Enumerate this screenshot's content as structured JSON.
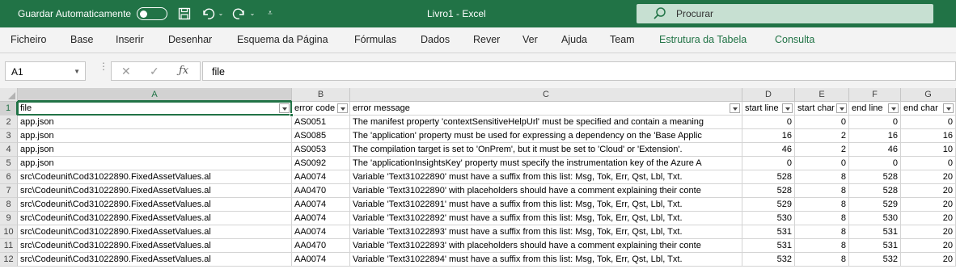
{
  "titlebar": {
    "autosave_label": "Guardar Automaticamente",
    "doc_title": "Livro1  -  Excel",
    "search_label": "Procurar",
    "accent_color": "#217346"
  },
  "ribbon": {
    "tabs": [
      "Ficheiro",
      "Base",
      "Inserir",
      "Desenhar",
      "Esquema da Página",
      "Fórmulas",
      "Dados",
      "Rever",
      "Ver",
      "Ajuda",
      "Team",
      "Estrutura da Tabela",
      "Consulta"
    ]
  },
  "formula_bar": {
    "name_box": "A1",
    "content": "file"
  },
  "columns": [
    "A",
    "B",
    "C",
    "D",
    "E",
    "F",
    "G"
  ],
  "header_row": [
    "file",
    "error code",
    "error message",
    "start line",
    "start char",
    "end line",
    "end char"
  ],
  "rows": [
    {
      "n": "1"
    },
    {
      "n": "2",
      "cells": [
        "app.json",
        "AS0051",
        "The manifest property 'contextSensitiveHelpUrl' must be specified and contain a meaning",
        "0",
        "0",
        "0",
        "0"
      ]
    },
    {
      "n": "3",
      "cells": [
        "app.json",
        "AS0085",
        "The 'application' property must be used for expressing a dependency on the 'Base Applic",
        "16",
        "2",
        "16",
        "16"
      ]
    },
    {
      "n": "4",
      "cells": [
        "app.json",
        "AS0053",
        "The compilation target is set to 'OnPrem', but it must be set to 'Cloud' or 'Extension'.",
        "46",
        "2",
        "46",
        "10"
      ]
    },
    {
      "n": "5",
      "cells": [
        "app.json",
        "AS0092",
        "The 'applicationInsightsKey' property must specify the instrumentation key of the Azure A",
        "0",
        "0",
        "0",
        "0"
      ]
    },
    {
      "n": "6",
      "cells": [
        "src\\Codeunit\\Cod31022890.FixedAssetValues.al",
        "AA0074",
        "Variable 'Text31022890' must have a suffix from this list: Msg, Tok, Err, Qst, Lbl, Txt.",
        "528",
        "8",
        "528",
        "20"
      ]
    },
    {
      "n": "7",
      "cells": [
        "src\\Codeunit\\Cod31022890.FixedAssetValues.al",
        "AA0470",
        "Variable 'Text31022890' with placeholders should have a comment explaining their conte",
        "528",
        "8",
        "528",
        "20"
      ]
    },
    {
      "n": "8",
      "cells": [
        "src\\Codeunit\\Cod31022890.FixedAssetValues.al",
        "AA0074",
        "Variable 'Text31022891' must have a suffix from this list: Msg, Tok, Err, Qst, Lbl, Txt.",
        "529",
        "8",
        "529",
        "20"
      ]
    },
    {
      "n": "9",
      "cells": [
        "src\\Codeunit\\Cod31022890.FixedAssetValues.al",
        "AA0074",
        "Variable 'Text31022892' must have a suffix from this list: Msg, Tok, Err, Qst, Lbl, Txt.",
        "530",
        "8",
        "530",
        "20"
      ]
    },
    {
      "n": "10",
      "cells": [
        "src\\Codeunit\\Cod31022890.FixedAssetValues.al",
        "AA0074",
        "Variable 'Text31022893' must have a suffix from this list: Msg, Tok, Err, Qst, Lbl, Txt.",
        "531",
        "8",
        "531",
        "20"
      ]
    },
    {
      "n": "11",
      "cells": [
        "src\\Codeunit\\Cod31022890.FixedAssetValues.al",
        "AA0470",
        "Variable 'Text31022893' with placeholders should have a comment explaining their conte",
        "531",
        "8",
        "531",
        "20"
      ]
    },
    {
      "n": "12",
      "cells": [
        "src\\Codeunit\\Cod31022890.FixedAssetValues.al",
        "AA0074",
        "Variable 'Text31022894' must have a suffix from this list: Msg, Tok, Err, Qst, Lbl, Txt.",
        "532",
        "8",
        "532",
        "20"
      ]
    }
  ]
}
